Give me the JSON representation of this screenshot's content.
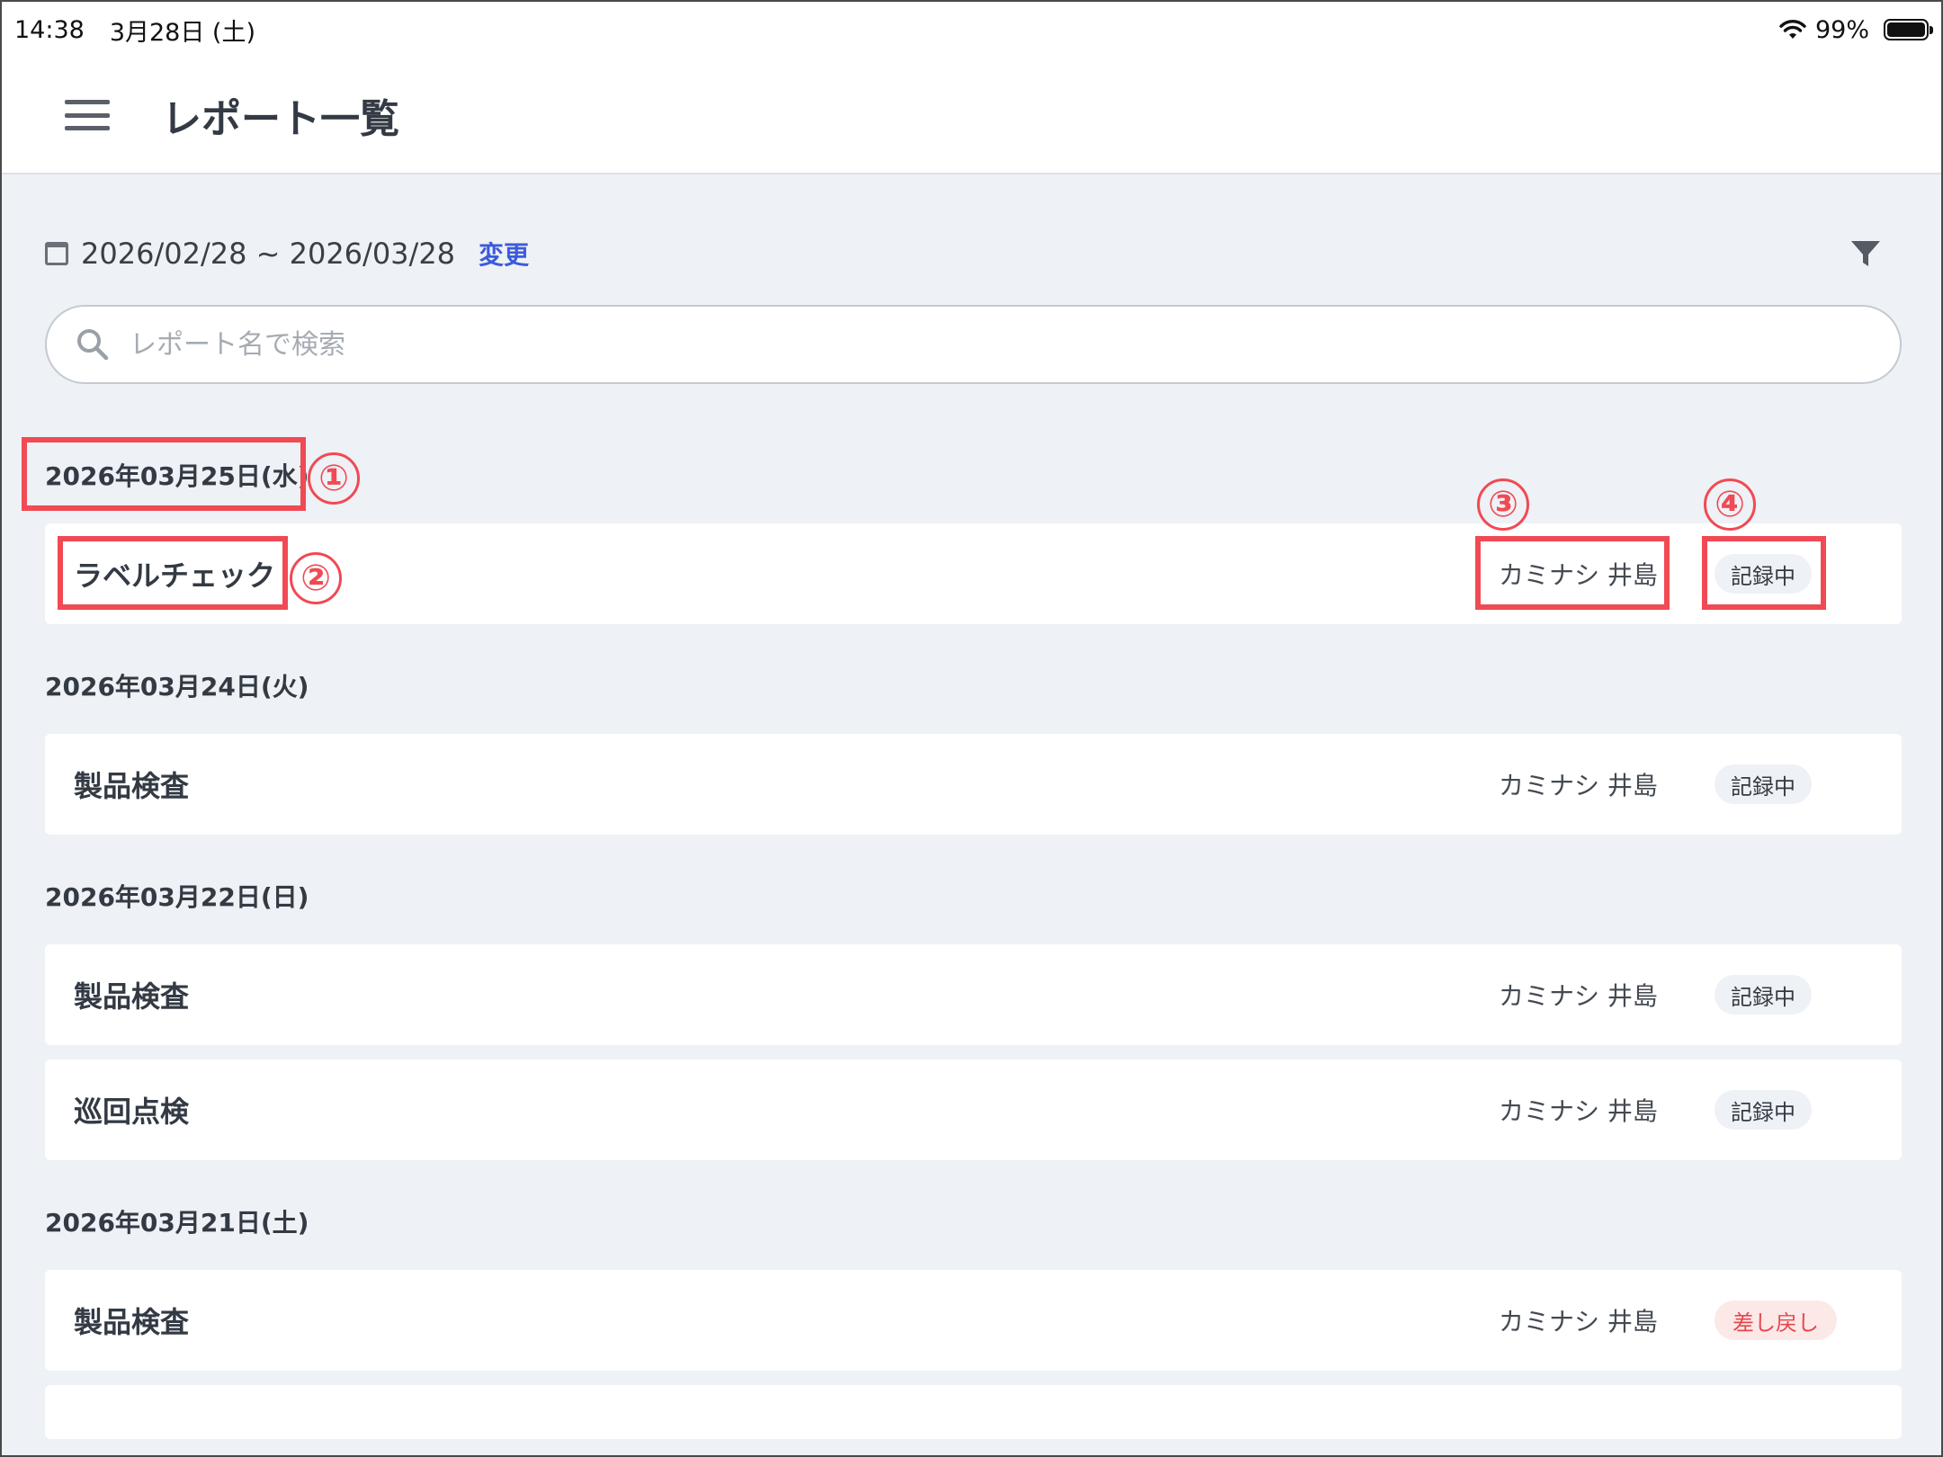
{
  "status_bar": {
    "time": "14:38",
    "date": "3月28日 (土)",
    "battery": "99%",
    "wifi_icon": "wifi-icon",
    "battery_icon": "battery-icon"
  },
  "header": {
    "menu_icon": "hamburger-menu-icon",
    "title": "レポート一覧"
  },
  "filter_bar": {
    "calendar_icon": "calendar-icon",
    "date_range": "2026/02/28 ~ 2026/03/28",
    "change_label": "変更",
    "filter_icon": "filter-funnel-icon"
  },
  "search": {
    "placeholder": "レポート名で検索",
    "value": ""
  },
  "groups": [
    {
      "date": "2026年03月25日(水)",
      "reports": [
        {
          "name": "ラベルチェック",
          "author": "カミナシ 井島",
          "status": "記録中"
        }
      ]
    },
    {
      "date": "2026年03月24日(火)",
      "reports": [
        {
          "name": "製品検査",
          "author": "カミナシ 井島",
          "status": "記録中"
        }
      ]
    },
    {
      "date": "2026年03月22日(日)",
      "reports": [
        {
          "name": "製品検査",
          "author": "カミナシ 井島",
          "status": "記録中"
        },
        {
          "name": "巡回点検",
          "author": "カミナシ 井島",
          "status": "記録中"
        }
      ]
    },
    {
      "date": "2026年03月21日(土)",
      "reports": [
        {
          "name": "製品検査",
          "author": "カミナシ 井島",
          "status": "差し戻し"
        }
      ]
    }
  ],
  "annotations": {
    "labels": [
      "①",
      "②",
      "③",
      "④"
    ],
    "color": "#f04a54"
  },
  "colors": {
    "accent_link": "#3b5bdb",
    "background": "#eef1f5",
    "returned_status": "#e5484d"
  }
}
